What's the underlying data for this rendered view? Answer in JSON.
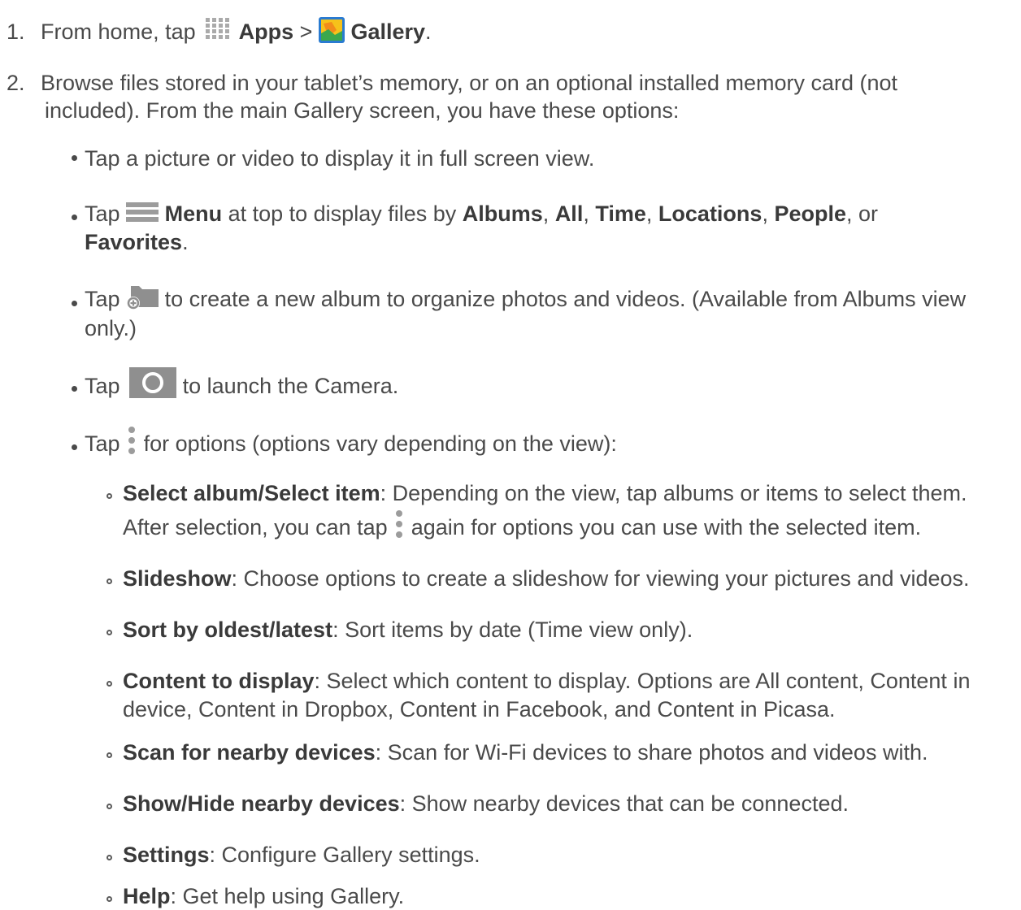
{
  "step1": {
    "number": "1.",
    "pre": "From home, tap",
    "apps": "Apps",
    "sep": ">",
    "gallery": "Gallery",
    "end": "."
  },
  "step2": {
    "number": "2.",
    "line1": "Browse files stored in your tablet’s memory, or on an optional installed memory card (not",
    "line2": "included). From the main Gallery screen, you have these options:"
  },
  "b1": {
    "text": "Tap a picture or video to display it in full screen view."
  },
  "b2": {
    "tap": "Tap",
    "menu": "Menu",
    "mid": "at top to display files by",
    "albums": "Albums",
    "all": "All",
    "time": "Time",
    "locations": "Locations",
    "people": "People",
    "or": ", or",
    "favorites": "Favorites",
    "comma": ",",
    "period": "."
  },
  "b3": {
    "tap": "Tap",
    "line1": "to create a new album to organize photos and videos. (Available from Albums view",
    "line2": "only.)"
  },
  "b4": {
    "tap": "Tap",
    "rest": "to launch the Camera."
  },
  "b5": {
    "tap": "Tap",
    "rest": "for options (options vary depending on the view):"
  },
  "sub": {
    "s1": {
      "term": "Select album/Select item",
      "desc": ": Depending on the view, tap albums or items to select them.",
      "line2a": "After selection, you can tap",
      "line2b": "again for options you can use with the selected item."
    },
    "s2": {
      "term": "Slideshow",
      "desc": ": Choose options to create a slideshow for viewing your pictures and videos."
    },
    "s3": {
      "term": "Sort by oldest/latest",
      "desc": ": Sort items by date (Time view only)."
    },
    "s4": {
      "term": "Content to display",
      "desc": ": Select which content to display. Options are All content, Content in",
      "line2": "device, Content in Dropbox, Content in Facebook, and Content in Picasa."
    },
    "s5": {
      "term": "Scan for nearby devices",
      "desc": ": Scan for Wi-Fi devices to share photos and videos with."
    },
    "s6": {
      "term": "Show/Hide nearby devices",
      "desc": ": Show nearby devices that can be connected."
    },
    "s7": {
      "term": "Settings",
      "desc": ": Configure Gallery settings."
    },
    "s8": {
      "term": "Help",
      "desc": ": Get help using Gallery."
    }
  },
  "icons": {
    "apps": "apps-grid-icon",
    "gallery": "gallery-app-icon",
    "menu": "menu-icon",
    "new_album": "new-album-icon",
    "camera": "camera-icon",
    "more": "more-options-icon"
  }
}
